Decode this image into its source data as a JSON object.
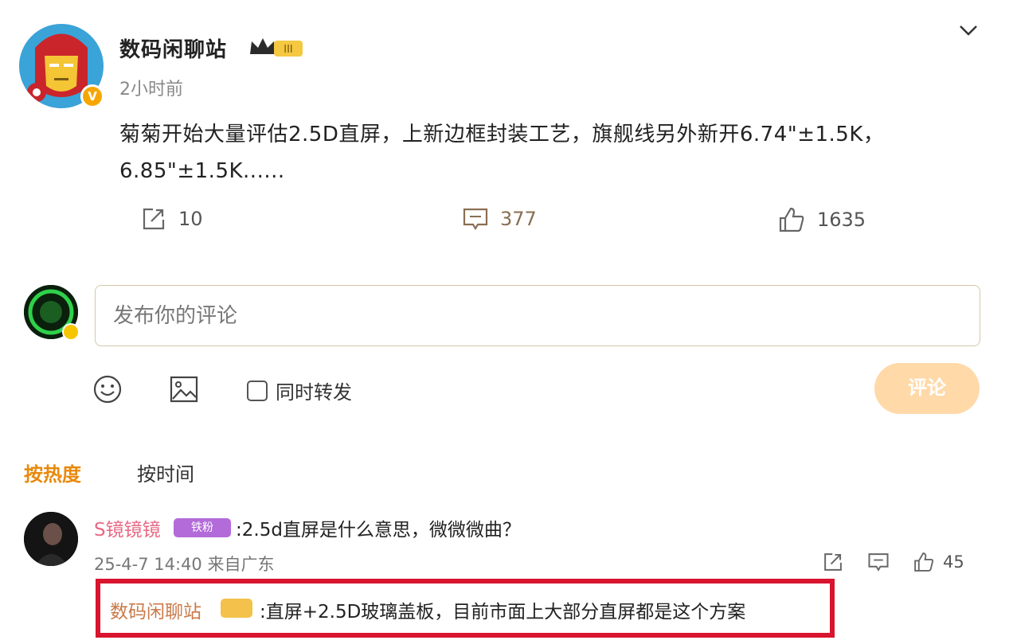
{
  "post": {
    "author": "数码闲聊站",
    "level_badge": "III",
    "time": "2小时前",
    "text_line1": "菊菊开始大量评估2.5D直屏，上新边框封装工艺，旗舰线另外新开6.74\"±1.5K，",
    "text_line2": "6.85\"±1.5K......",
    "reposts": "10",
    "comments": "377",
    "likes": "1635"
  },
  "composer": {
    "placeholder": "发布你的评论",
    "repost_label": "同时转发",
    "submit_label": "评论"
  },
  "sort_tabs": {
    "hot": "按热度",
    "time": "按时间"
  },
  "comment": {
    "user": "S镜镜镜",
    "badge": "铁粉",
    "text": ":2.5d直屏是什么意思，微微微曲？",
    "meta": "25-4-7 14:40 来自广东",
    "likes": "45",
    "reply": {
      "user": "数码闲聊站",
      "text": ":直屏+2.5D玻璃盖板，目前市面上大部分直屏都是这个方案"
    }
  },
  "colors": {
    "accent": "#e8890c",
    "highlight_border": "#d8142e",
    "submit_disabled": "#ffd9a8"
  }
}
